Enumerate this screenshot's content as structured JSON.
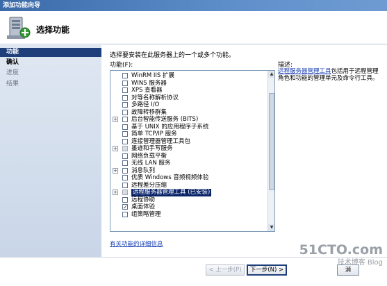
{
  "window": {
    "title": "添加功能向导"
  },
  "header": {
    "title": "选择功能",
    "icon": "server-add-icon"
  },
  "sidebar": {
    "items": [
      {
        "label": "功能",
        "state": "active"
      },
      {
        "label": "确认",
        "state": "current"
      },
      {
        "label": "进度",
        "state": "pending"
      },
      {
        "label": "结果",
        "state": "pending"
      }
    ]
  },
  "main": {
    "intro": "选择要安装在此服务器上的一个或多个功能。",
    "list_label": "功能(F):",
    "features": [
      {
        "label": "WinRM IIS 扩展",
        "checked": false,
        "expandable": false
      },
      {
        "label": "WINS 服务器",
        "checked": false,
        "expandable": false
      },
      {
        "label": "XPS 查看器",
        "checked": false,
        "expandable": false
      },
      {
        "label": "对等名称解析协议",
        "checked": false,
        "expandable": false
      },
      {
        "label": "多路径 I/O",
        "checked": false,
        "expandable": false
      },
      {
        "label": "故障转移群集",
        "checked": false,
        "expandable": false
      },
      {
        "label": "后台智能传送服务 (BITS)",
        "checked": false,
        "expandable": true
      },
      {
        "label": "基于 UNIX 的应用程序子系统",
        "checked": false,
        "expandable": false
      },
      {
        "label": "简单 TCP/IP 服务",
        "checked": false,
        "expandable": false
      },
      {
        "label": "连接管理器管理工具包",
        "checked": false,
        "expandable": false
      },
      {
        "label": "墨迹和手写服务",
        "checked": false,
        "expandable": true,
        "indeterminate": true
      },
      {
        "label": "网络负载平衡",
        "checked": false,
        "expandable": false
      },
      {
        "label": "无线 LAN 服务",
        "checked": false,
        "expandable": false
      },
      {
        "label": "消息队列",
        "checked": false,
        "expandable": true
      },
      {
        "label": "优质 Windows 音频视频体验",
        "checked": false,
        "expandable": false
      },
      {
        "label": "远程差分压缩",
        "checked": false,
        "expandable": false
      },
      {
        "label": "远程服务器管理工具   (已安装)",
        "checked": false,
        "expandable": true,
        "indeterminate": true,
        "selected": true
      },
      {
        "label": "远程协助",
        "checked": false,
        "expandable": false
      },
      {
        "label": "桌面体验",
        "checked": true,
        "expandable": false
      },
      {
        "label": "组策略管理",
        "checked": false,
        "expandable": false
      }
    ],
    "description": {
      "title": "描述:",
      "link": "远程服务器管理工具",
      "text": "包括用于远程管理角色和功能的管理单元及命令行工具。"
    },
    "more_link": "有关功能的详细信息"
  },
  "footer": {
    "back": "< 上一步(P)",
    "next": "下一步(N) >",
    "cancel": "消"
  },
  "watermark": {
    "main": "51CTO.com",
    "sub": "技术博客  Blog"
  }
}
